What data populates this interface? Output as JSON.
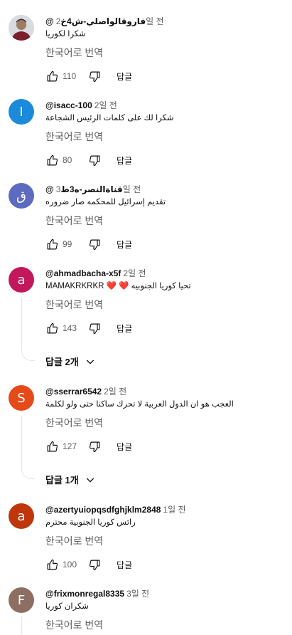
{
  "translate_label": "한국어로 번역",
  "reply_label": "답글",
  "colors": {
    "blue": "#1c8adb",
    "indigo": "#5c6bc0",
    "magenta": "#c2185b",
    "orange": "#e64a19",
    "rust": "#bf360c",
    "taupe": "#8d6e63"
  },
  "comments": [
    {
      "author": "@فاروقالواصلي-ش4خ",
      "time": "2일 전",
      "text": "شكرا لكوريا",
      "likes": "110",
      "avatar_letter": "",
      "avatar_color": "#c9cdd3"
    },
    {
      "author": "@isacc-100",
      "time": "2일 전",
      "text": "شكرا لك على كلمات الرئيس الشجاعة",
      "likes": "80",
      "avatar_letter": "I",
      "avatar_color": "#1c8adb"
    },
    {
      "author": "@قناةالنصر-ه3ط",
      "time": "3일 전",
      "text": "تقديم إسرائيل للمحكمه صار ضروره",
      "likes": "99",
      "avatar_letter": "ق",
      "avatar_color": "#5c6bc0"
    },
    {
      "author": "@ahmadbacha-x5f",
      "time": "2일 전",
      "text": "تحيا كوريا الجنوبيه ❤️ ❤️ MAMAKRKRKR",
      "likes": "143",
      "avatar_letter": "a",
      "avatar_color": "#c2185b",
      "replies": "답글 2개"
    },
    {
      "author": "@sserrar6542",
      "time": "2일 전",
      "text": "العجب هو ان الدول العربية لا تحرك ساكنا حتى ولو لكلمة",
      "likes": "127",
      "avatar_letter": "S",
      "avatar_color": "#e64a19",
      "replies": "답글 1개"
    },
    {
      "author": "@azertyuiopqsdfghjklm2848",
      "time": "1일 전",
      "text": "رائس كوريا الجنوبية  محترم",
      "likes": "100",
      "avatar_letter": "a",
      "avatar_color": "#bf360c"
    },
    {
      "author": "@frixmonregal8335",
      "time": "3일 전",
      "text": "شكران  كوريا",
      "likes": "",
      "avatar_letter": "F",
      "avatar_color": "#8d6e63"
    }
  ]
}
